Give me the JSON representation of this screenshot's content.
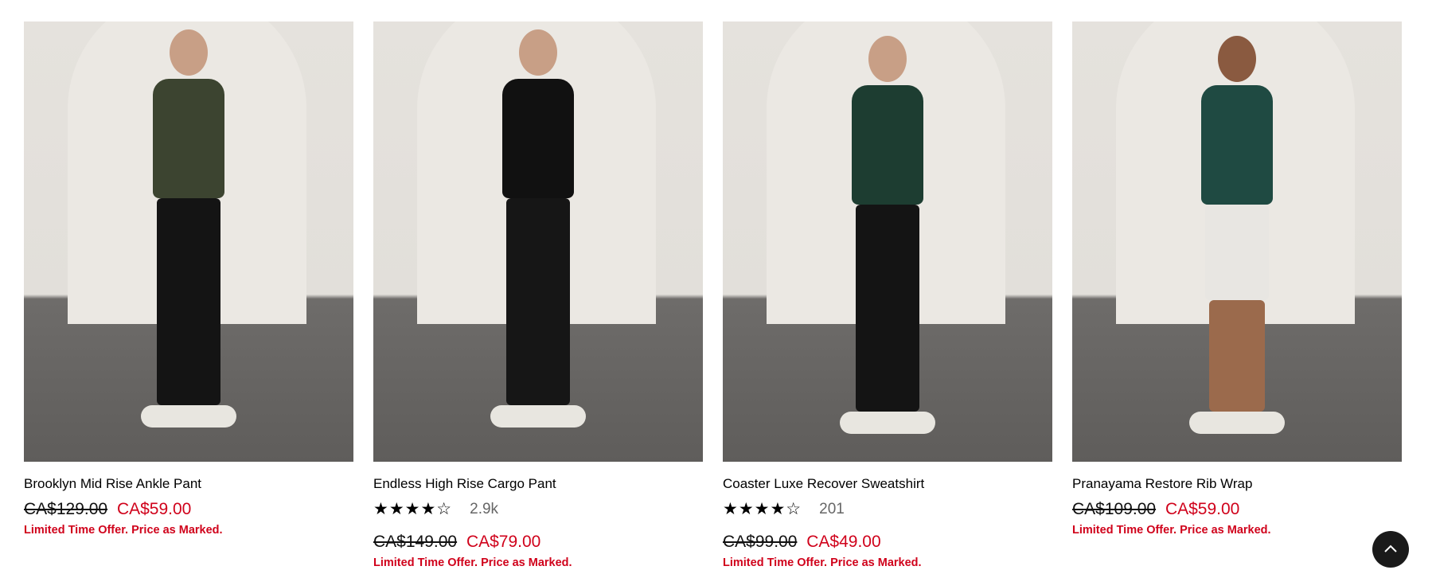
{
  "products": [
    {
      "title": "Brooklyn Mid Rise Ankle Pant",
      "old_price": "CA$129.00",
      "new_price": "CA$59.00",
      "promo": "Limited Time Offer. Price as Marked.",
      "torso": "#3c4430",
      "legs": "#141414"
    },
    {
      "title": "Endless High Rise Cargo Pant",
      "stars": "★★★★☆",
      "rating": 4.5,
      "review_count": "2.9k",
      "old_price": "CA$149.00",
      "new_price": "CA$79.00",
      "promo": "Limited Time Offer. Price as Marked.",
      "torso": "#111111",
      "legs": "#161616"
    },
    {
      "title": "Coaster Luxe Recover Sweatshirt",
      "stars": "★★★★☆",
      "rating": 4.5,
      "review_count": "201",
      "old_price": "CA$99.00",
      "new_price": "CA$49.00",
      "promo": "Limited Time Offer. Price as Marked.",
      "torso": "#1d3d31",
      "legs": "#141414"
    },
    {
      "title": "Pranayama Restore Rib Wrap",
      "old_price": "CA$109.00",
      "new_price": "CA$59.00",
      "promo": "Limited Time Offer. Price as Marked.",
      "torso": "#1f4a42",
      "legs": "#e8e6e2"
    }
  ],
  "scroll_top_icon": "chevron-up-icon"
}
